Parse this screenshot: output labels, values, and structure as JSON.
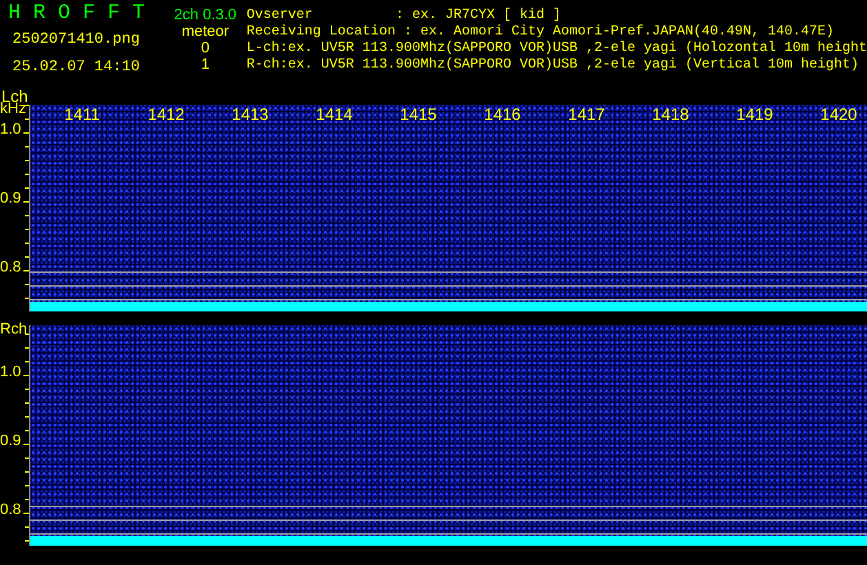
{
  "header": {
    "title": "H R O F F T",
    "filename": "2502071410.png",
    "datetime": "25.02.07 14:10",
    "version": "2ch 0.3.0",
    "meteor_label": "meteor",
    "meteor_counts": [
      "0",
      "1"
    ],
    "info_lines": [
      "Ovserver          : ex. JR7CYX [ kid ]",
      "Receiving Location : ex. Aomori City Aomori-Pref.JAPAN(40.49N, 140.47E)",
      "L-ch:ex. UV5R 113.900Mhz(SAPPORO VOR)USB ,2-ele yagi (Holozontal 10m height",
      "R-ch:ex. UV5R 113.900Mhz(SAPPORO VOR)USB ,2-ele yagi (Vertical 10m height)"
    ]
  },
  "channels": [
    {
      "label": "Lch",
      "unit": "kHz",
      "time_labels": [
        "1411",
        "1412",
        "1413",
        "1414",
        "1415",
        "1416",
        "1417",
        "1418",
        "1419",
        "1420"
      ],
      "freq_labels": [
        "1.0",
        "0.9",
        "0.8"
      ]
    },
    {
      "label": "Rch",
      "freq_labels": [
        "1.0",
        "0.9",
        "0.8"
      ]
    }
  ]
}
